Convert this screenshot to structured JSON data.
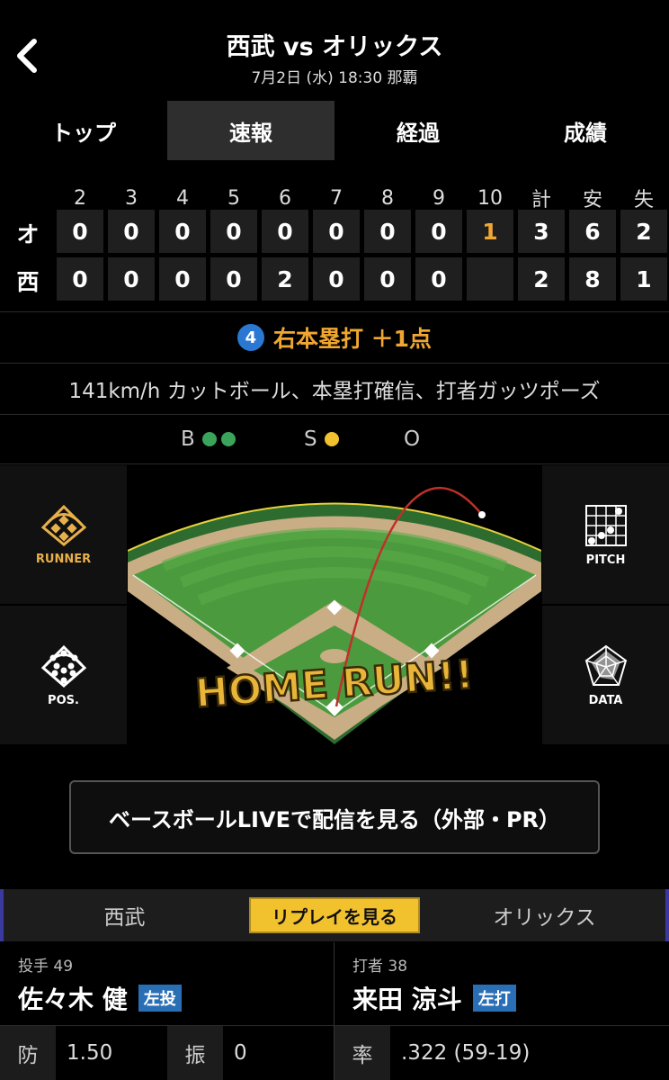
{
  "header": {
    "title": "西武 vs オリックス",
    "subtitle": "7月2日 (水) 18:30 那覇"
  },
  "tabs": [
    {
      "label": "トップ",
      "active": false
    },
    {
      "label": "速報",
      "active": true
    },
    {
      "label": "経過",
      "active": false
    },
    {
      "label": "成績",
      "active": false
    }
  ],
  "scoreboard": {
    "headers": [
      "2",
      "3",
      "4",
      "5",
      "6",
      "7",
      "8",
      "9",
      "10",
      "計",
      "安",
      "失"
    ],
    "rows": [
      {
        "team": "オ",
        "cells": [
          "0",
          "0",
          "0",
          "0",
          "0",
          "0",
          "0",
          "0",
          "1",
          "3",
          "6",
          "2"
        ]
      },
      {
        "team": "西",
        "cells": [
          "0",
          "0",
          "0",
          "0",
          "2",
          "0",
          "0",
          "0",
          "",
          "2",
          "8",
          "1"
        ]
      }
    ],
    "highlight_color": "#f0a732"
  },
  "event": {
    "number": "4",
    "text": "右本塁打 ＋1点"
  },
  "description": "141km/h カットボール、本塁打確信、打者ガッツポーズ",
  "count": {
    "b_label": "B",
    "b_count": 2,
    "s_label": "S",
    "s_count": 1,
    "o_label": "O",
    "o_count": 0
  },
  "side_buttons": {
    "runner": "RUNNER",
    "pos": "POS.",
    "pitch": "PITCH",
    "data": "DATA"
  },
  "field": {
    "banner": "HOME RUN!!"
  },
  "live_button": "ベースボールLIVEで配信を見る（外部・PR）",
  "teambar": {
    "left": "西武",
    "replay": "リプレイを見る",
    "right": "オリックス"
  },
  "pitcher": {
    "role": "投手 49",
    "name": "佐々木 健",
    "hand": "左投",
    "stats": [
      {
        "label": "防",
        "value": "1.50"
      },
      {
        "label": "振",
        "value": "0"
      }
    ]
  },
  "batter": {
    "role": "打者 38",
    "name": "来田 涼斗",
    "hand": "左打",
    "stats": [
      {
        "label": "率",
        "value": ".322 (59-19)"
      }
    ]
  }
}
